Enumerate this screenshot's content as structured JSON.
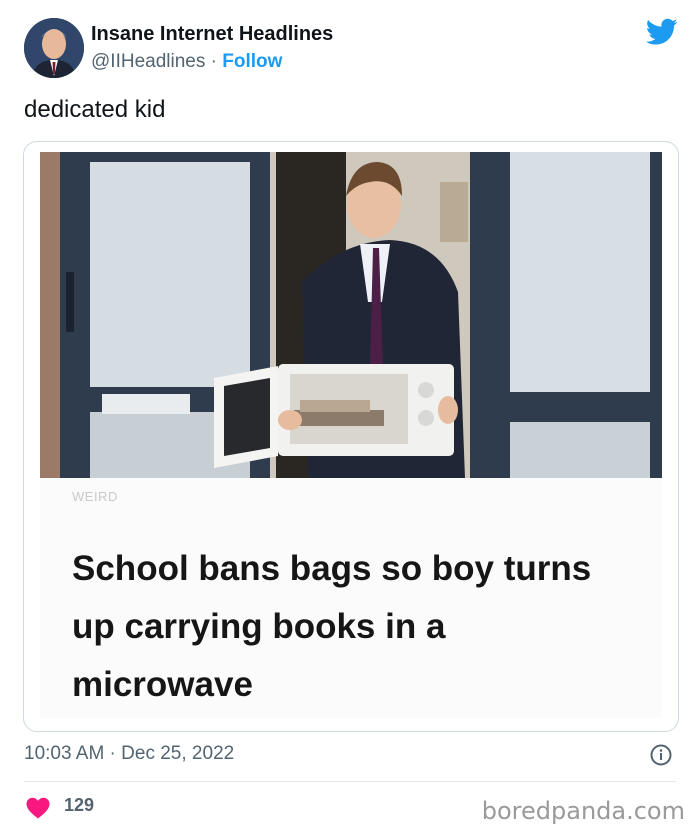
{
  "tweet": {
    "display_name": "Insane Internet Headlines",
    "handle": "@IIHeadlines",
    "separator": " · ",
    "follow_label": "Follow",
    "text": "dedicated kid",
    "time": "10:03 AM",
    "date_separator": " · ",
    "date": "Dec 25, 2022",
    "likes": "129"
  },
  "article": {
    "tag": "WEIRD",
    "headline": "School bans bags so boy turns up carrying books in a microwave"
  },
  "watermark": "boredpanda.com",
  "icons": {
    "platform": "twitter-bird-icon",
    "info": "info-icon",
    "like": "heart-icon"
  },
  "colors": {
    "accent": "#1d9bf0",
    "heart": "#f91880",
    "secondary_text": "#536471"
  }
}
